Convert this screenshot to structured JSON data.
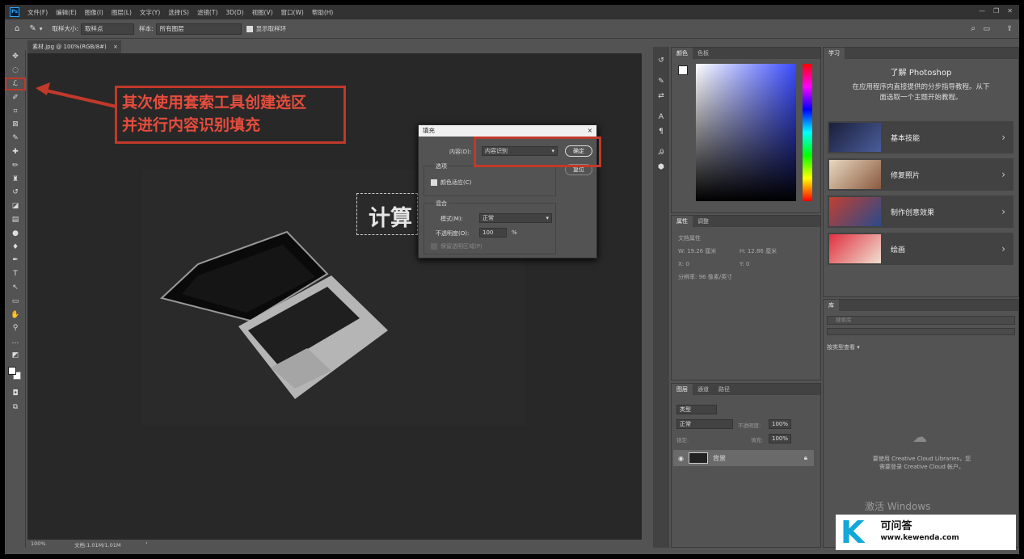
{
  "app": {
    "logo_text": "Ps"
  },
  "menu": [
    "文件(F)",
    "编辑(E)",
    "图像(I)",
    "图层(L)",
    "文字(Y)",
    "选择(S)",
    "滤镜(T)",
    "3D(D)",
    "视图(V)",
    "窗口(W)",
    "帮助(H)"
  ],
  "options": {
    "sample_size_label": "取样大小:",
    "sample_size_value": "取样点",
    "sample_label": "样本:",
    "sample_value": "所有图层",
    "show_ring": "显示取样环"
  },
  "document": {
    "tab": "素材.jpg @ 100%(RGB/8#)",
    "close": "×",
    "zoom": "100%",
    "docinfo": "文档:1.01M/1.01M",
    "status_arrow": "›"
  },
  "canvas_text": "计算",
  "annotation": {
    "line1": "其次使用套索工具创建选区",
    "line2": "并进行内容识别填充"
  },
  "fill_dialog": {
    "title": "填充",
    "close": "×",
    "content_label": "内容(D):",
    "content_value": "内容识别",
    "ok": "确定",
    "reset": "复位",
    "options_group": "选项",
    "color_adapt": "颜色适应(C)",
    "blend_group": "混合",
    "mode_label": "模式(M):",
    "mode_value": "正常",
    "opacity_label": "不透明度(O):",
    "opacity_value": "100",
    "opacity_unit": "%",
    "preserve": "保留透明区域(P)"
  },
  "color_panel": {
    "tabs": [
      "颜色",
      "色板"
    ]
  },
  "properties_panel": {
    "tabs": [
      "属性",
      "调整"
    ],
    "doc_props": "文档属性",
    "w": "W: 19.26 厘米",
    "h": "H: 12.86 厘米",
    "x": "X: 0",
    "y": "Y: 0",
    "res": "分辨率: 96 像素/英寸"
  },
  "layers_panel": {
    "tabs": [
      "图层",
      "通道",
      "路径"
    ],
    "kind": "类型",
    "blend": "正常",
    "opacity_label": "不透明度:",
    "opacity": "100%",
    "lock_label": "锁定:",
    "fill_label": "填充:",
    "fill": "100%",
    "layer_name": "背景"
  },
  "learn_panel": {
    "tab": "学习",
    "title": "了解 Photoshop",
    "desc1": "在应用程序内直接提供的分步指导教程。从下",
    "desc2": "面选取一个主题开始教程。",
    "items": [
      "基本技能",
      "修复照片",
      "制作创意效果",
      "绘画"
    ]
  },
  "library_panel": {
    "tab": "库",
    "search": "搜索库",
    "view_by": "按类型查看",
    "msg1": "要使用 Creative Cloud Libraries，您",
    "msg2": "需要登录 Creative Cloud 帐户。"
  },
  "watermark": {
    "activate": "激活 Windows",
    "logo_letter": "K",
    "logo_title": "可问答",
    "logo_url": "www.kewenda.com"
  },
  "colors": {
    "accent": "#31a8ff",
    "annotation": "#c0392b"
  }
}
